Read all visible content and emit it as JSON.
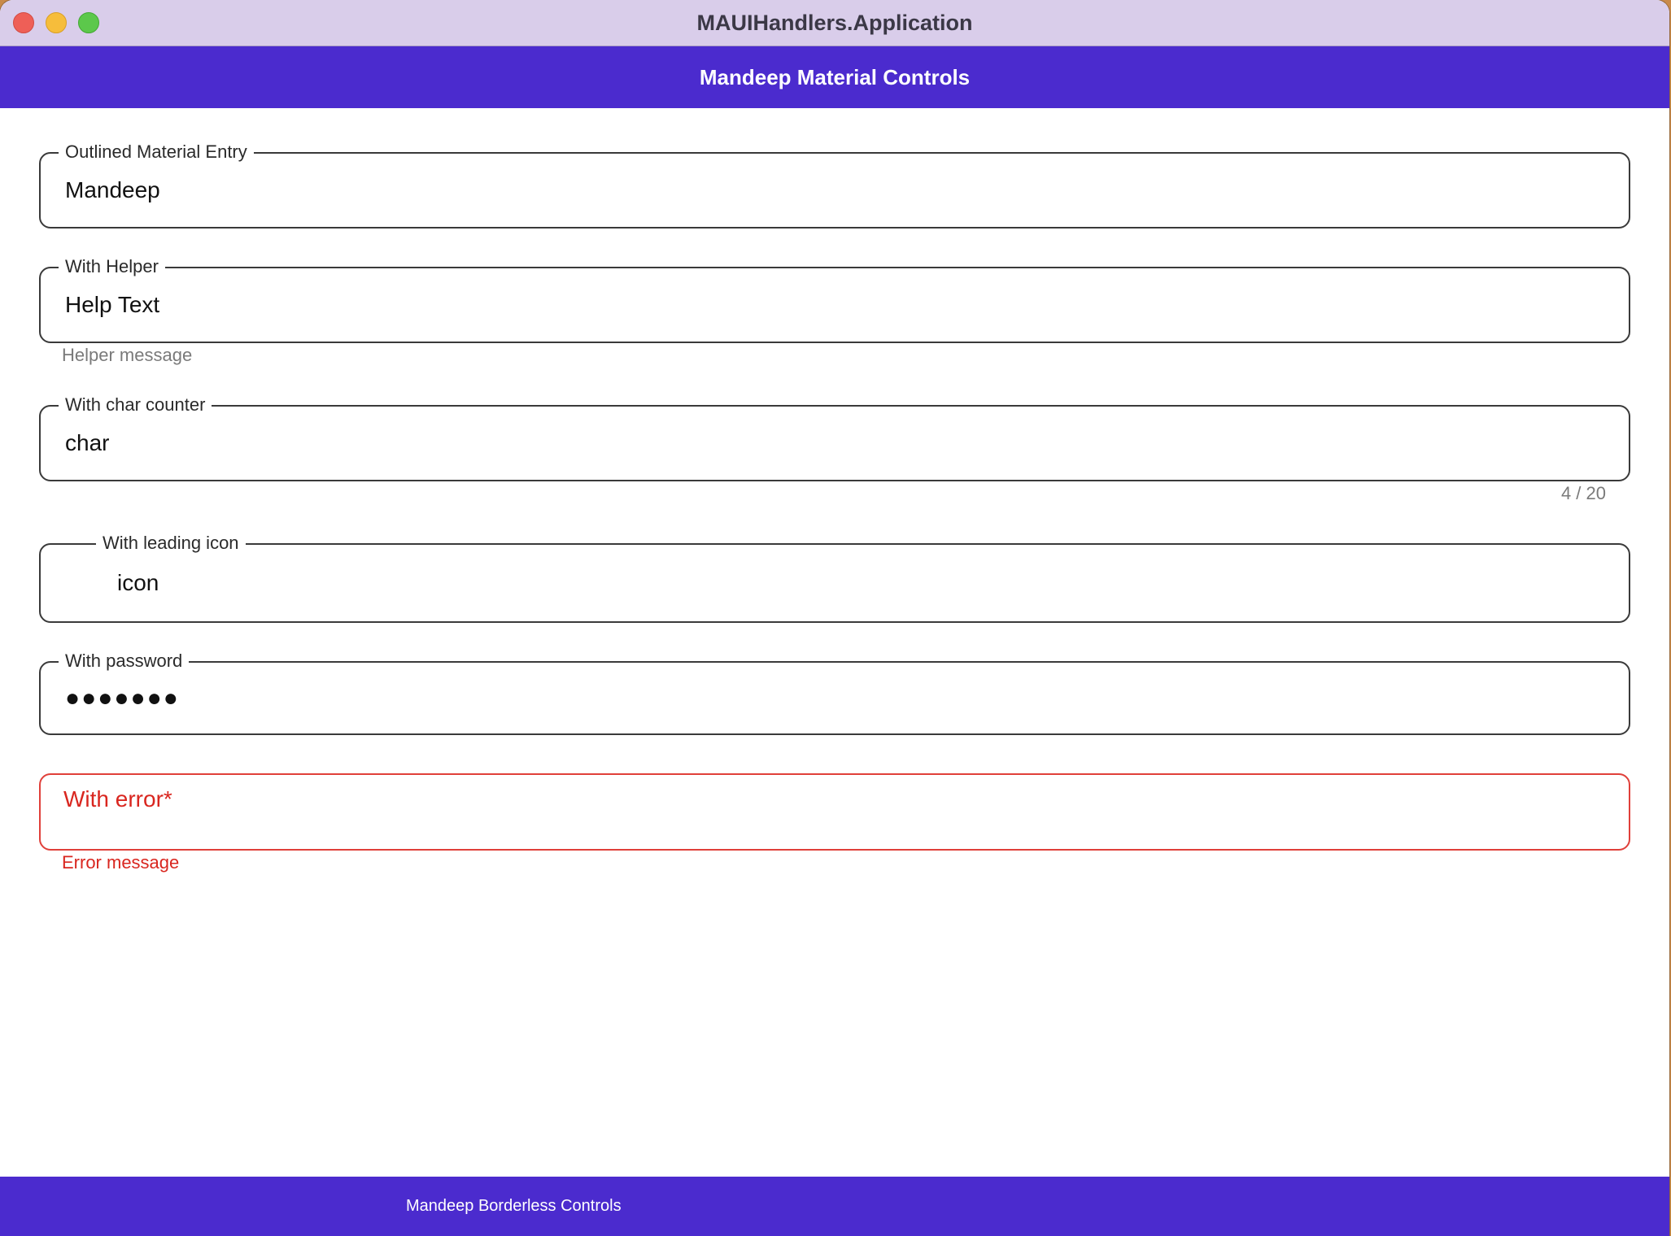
{
  "window": {
    "title": "MAUIHandlers.Application"
  },
  "navbar": {
    "title": "Mandeep Material Controls"
  },
  "fields": {
    "outlined": {
      "label": "Outlined Material Entry",
      "value": "Mandeep"
    },
    "helper": {
      "label": "With Helper",
      "value": "Help Text",
      "helper_text": "Helper message"
    },
    "counter": {
      "label": "With char counter",
      "value": "char",
      "counter_text": "4 / 20"
    },
    "leading_icon": {
      "label": "With leading icon",
      "value": "icon"
    },
    "password": {
      "label": "With password",
      "value": "●●●●●●●"
    },
    "error": {
      "label": "With error*",
      "error_text": "Error message"
    }
  },
  "bottom_tabs": {
    "items": [
      {
        "label": "Mandeep Borderless Controls"
      }
    ]
  },
  "colors": {
    "accent": "#4b2bce",
    "titlebar": "#d9cdea",
    "error": "#d9261f",
    "helper": "#7a7a7a"
  }
}
